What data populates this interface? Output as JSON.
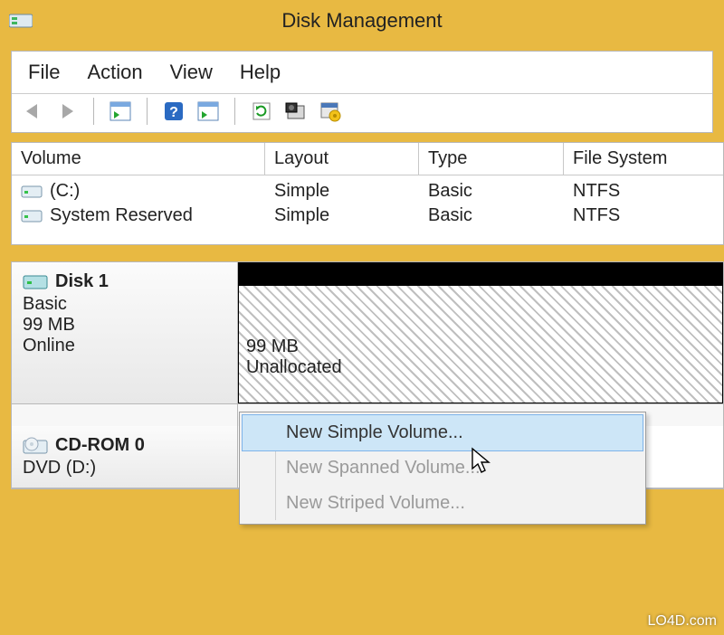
{
  "window": {
    "title": "Disk Management"
  },
  "menu": {
    "file": "File",
    "action": "Action",
    "view": "View",
    "help": "Help"
  },
  "table": {
    "headers": {
      "volume": "Volume",
      "layout": "Layout",
      "type": "Type",
      "fs": "File System"
    },
    "rows": [
      {
        "name": "(C:)",
        "layout": "Simple",
        "type": "Basic",
        "fs": "NTFS"
      },
      {
        "name": "System Reserved",
        "layout": "Simple",
        "type": "Basic",
        "fs": "NTFS"
      }
    ]
  },
  "disks": {
    "disk1": {
      "title": "Disk 1",
      "type": "Basic",
      "size": "99 MB",
      "status": "Online",
      "unalloc_size": "99 MB",
      "unalloc_label": "Unallocated"
    },
    "cdrom": {
      "title": "CD-ROM 0",
      "sub": "DVD (D:)"
    }
  },
  "context": {
    "new_simple": "New Simple Volume...",
    "new_spanned": "New Spanned Volume...",
    "new_striped": "New Striped Volume..."
  },
  "watermark": "LO4D.com"
}
